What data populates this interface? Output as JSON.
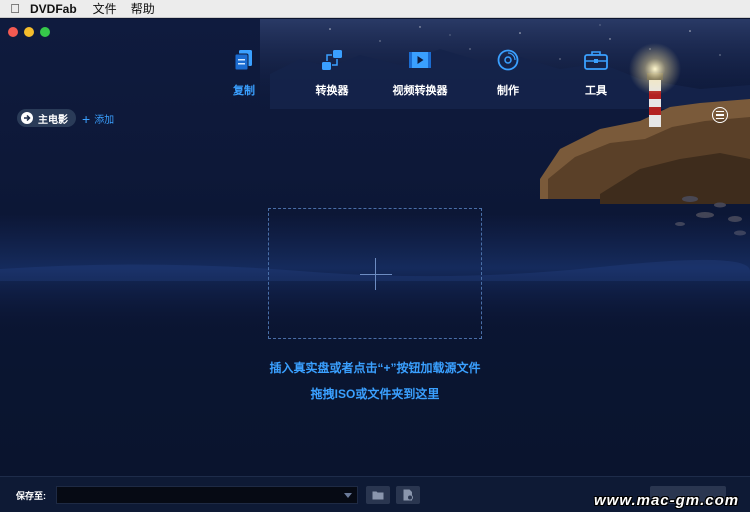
{
  "menubar": {
    "app_name": "DVDFab",
    "items": [
      "文件",
      "帮助"
    ]
  },
  "tabs": [
    {
      "label": "复制",
      "icon": "copy-icon",
      "active": true
    },
    {
      "label": "转换器",
      "icon": "converter-icon",
      "active": false
    },
    {
      "label": "视频转换器",
      "icon": "video-converter-icon",
      "active": false
    },
    {
      "label": "制作",
      "icon": "creator-disc-icon",
      "active": false
    },
    {
      "label": "工具",
      "icon": "toolbox-icon",
      "active": false
    }
  ],
  "toolbar": {
    "main_movie_label": "主电影",
    "add_label": "添加"
  },
  "dropzone": {
    "hint_line1": "插入真实盘或者点击“+”按钮加载源文件",
    "hint_line2": "拖拽ISO或文件夹到这里"
  },
  "bottom": {
    "save_to_label": "保存至:",
    "save_path_value": "",
    "watermark": "www.mac-gm.com"
  },
  "colors": {
    "accent": "#3aa0ff",
    "background": "#0b1430"
  }
}
